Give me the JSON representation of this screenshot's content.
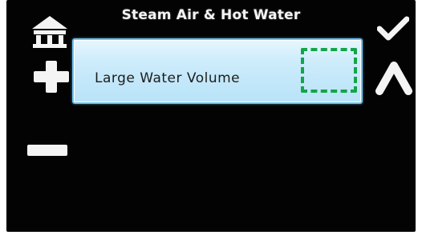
{
  "screen": {
    "title": "Steam Air & Hot Water"
  },
  "left_controls": {
    "home_icon": "home-icon",
    "plus_icon": "plus-icon",
    "minus_icon": "minus-icon"
  },
  "right_controls": {
    "check_icon": "checkmark-icon",
    "up_icon": "chevron-up-icon"
  },
  "list": {
    "selected_item_label": "Large Water Volume"
  },
  "colors": {
    "screen_background": "#030303",
    "item_background": "#c6e9fa",
    "item_border": "#6fc2f0",
    "highlight": "#14a44a",
    "icon": "#f4f4f4"
  }
}
